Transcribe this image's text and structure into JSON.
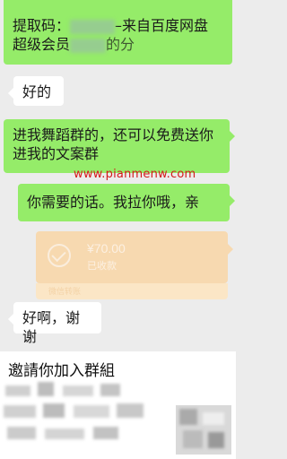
{
  "messages": [
    {
      "id": "msg1",
      "side": "right",
      "line1_prefix": "提取码：",
      "line1_suffix": "–来自百度网盘",
      "line2_prefix": "超级会员",
      "line2_suffix": "的分"
    },
    {
      "id": "msg2",
      "side": "left",
      "text": "好的"
    },
    {
      "id": "msg3",
      "side": "right",
      "text": "进我舞蹈群的，还可以免费送你进我的文案群"
    },
    {
      "id": "msg4",
      "side": "right",
      "text": "你需要的话。我拉你哦，亲"
    },
    {
      "id": "msg5",
      "side": "left",
      "text": "好啊，谢谢"
    }
  ],
  "watermark": "www.pianmenw.com",
  "transfer": {
    "amount": "¥70.00",
    "status": "已收款",
    "footer": "微信转账",
    "icon": "check-circle-icon"
  },
  "invite": {
    "title": "邀請你加入群組"
  },
  "colors": {
    "background": "#ececec",
    "self_bubble": "#95ec69",
    "other_bubble": "#ffffff",
    "transfer_card": "#f8d9ad",
    "watermark": "#d41a1a"
  }
}
